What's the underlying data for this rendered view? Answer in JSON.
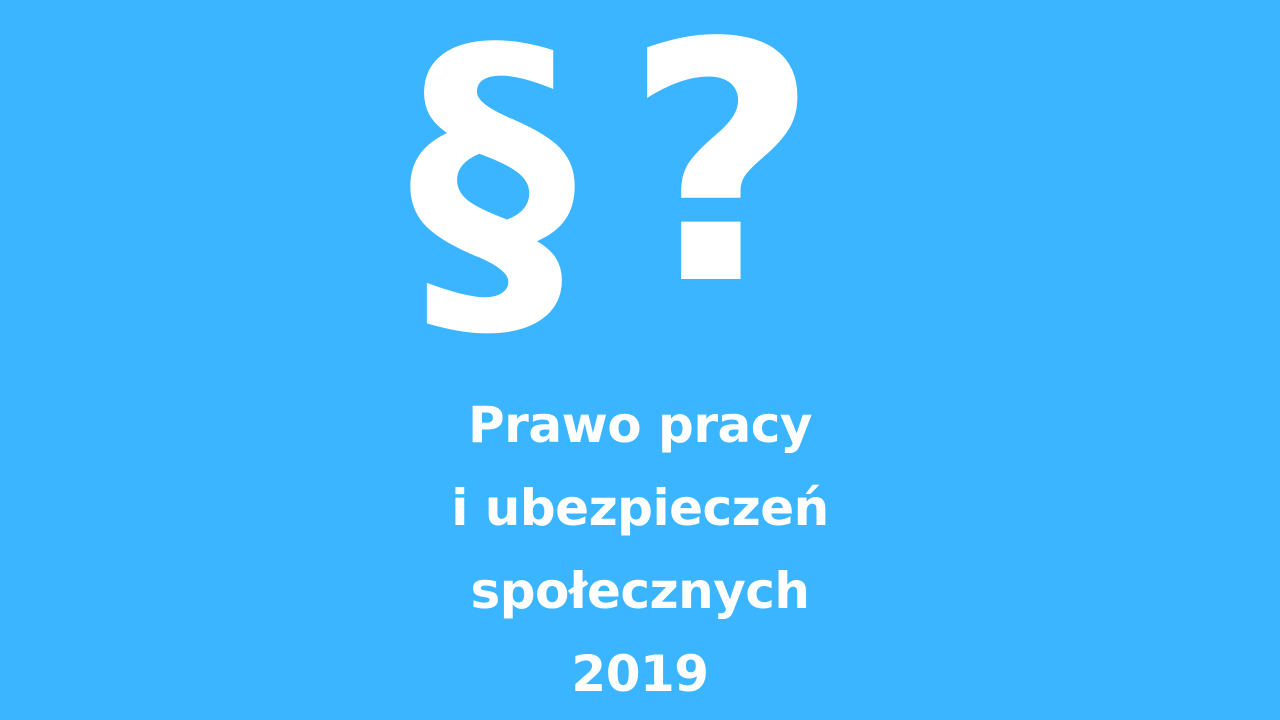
{
  "graphic": {
    "section_symbol": "§",
    "question_symbol": "?"
  },
  "title": {
    "lines": [
      "Prawo pracy",
      "i ubezpieczeń",
      "społecznych",
      "2019"
    ]
  },
  "colors": {
    "background": "#3bb5ff",
    "text": "#ffffff"
  }
}
